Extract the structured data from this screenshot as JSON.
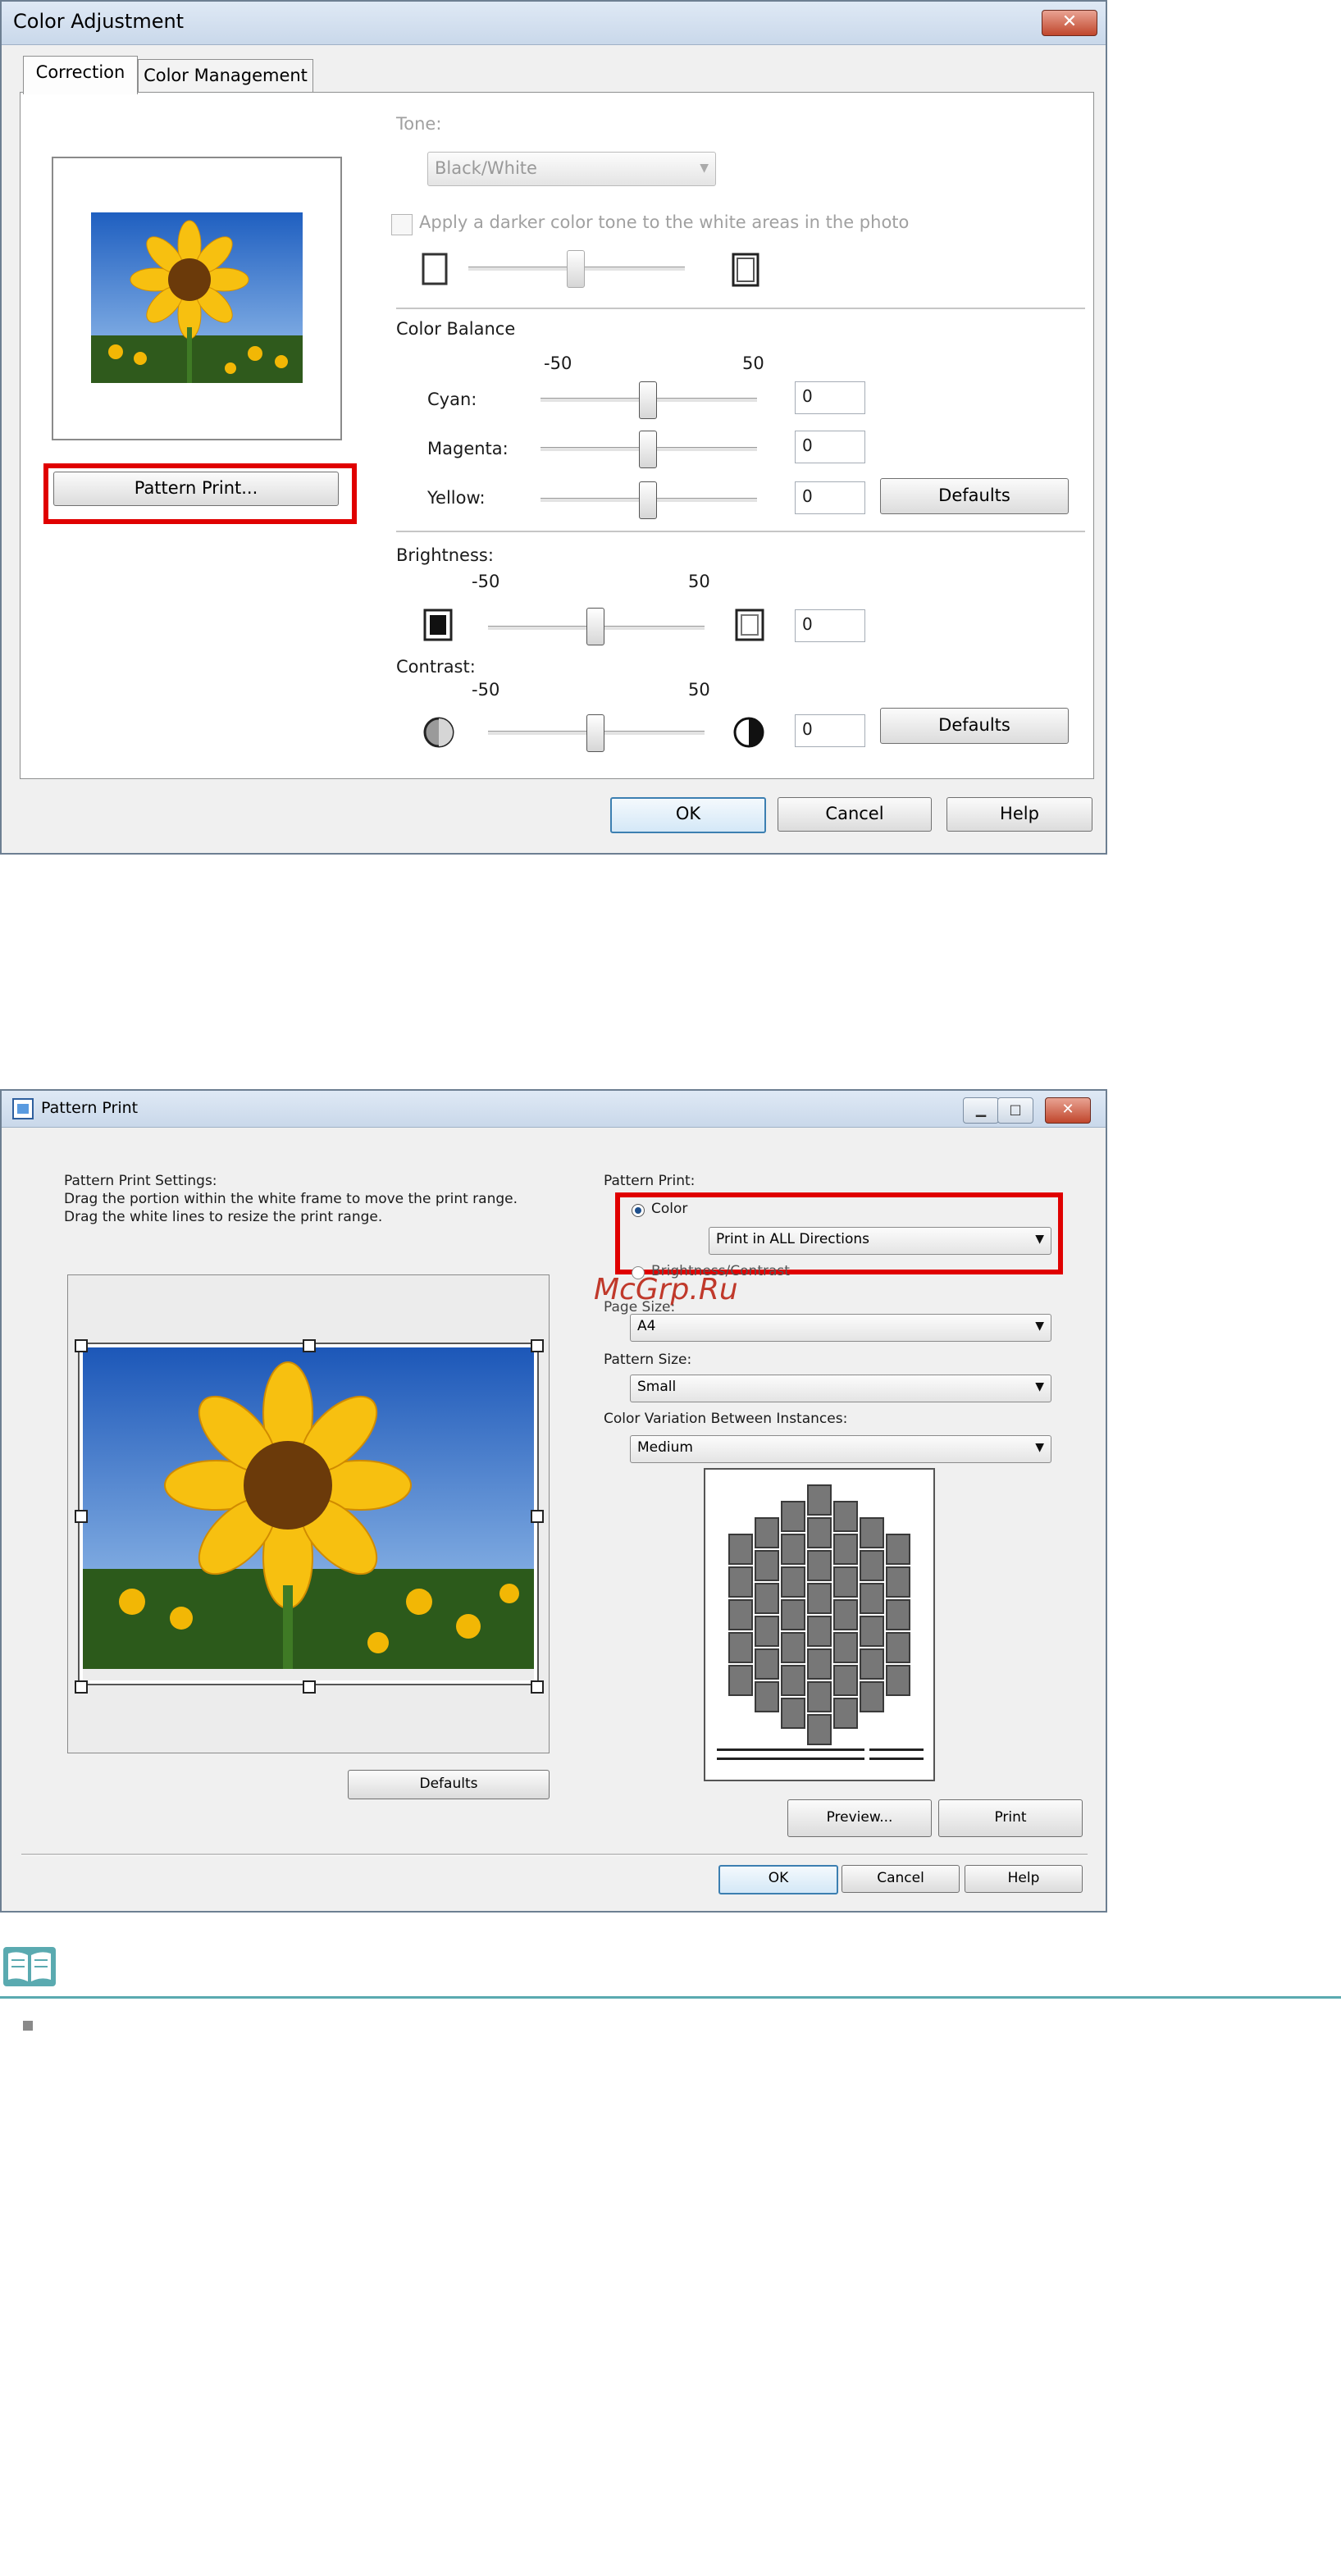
{
  "dialog1": {
    "title": "Color Adjustment",
    "close": "✕",
    "tabs": [
      "Correction",
      "Color Management"
    ],
    "pattern_print_button": "Pattern Print...",
    "tone_label": "Tone:",
    "tone_value": "Black/White",
    "darker_tone_label": "Apply a darker color tone to the white areas in the photo",
    "color_balance_label": "Color Balance",
    "scale_min": "-50",
    "scale_max": "50",
    "cyan_label": "Cyan:",
    "cyan_value": "0",
    "magenta_label": "Magenta:",
    "magenta_value": "0",
    "yellow_label": "Yellow:",
    "yellow_value": "0",
    "defaults_label": "Defaults",
    "brightness_label": "Brightness:",
    "brightness_value": "0",
    "contrast_label": "Contrast:",
    "contrast_value": "0",
    "ok_label": "OK",
    "cancel_label": "Cancel",
    "help_label": "Help"
  },
  "dialog2": {
    "title": "Pattern Print",
    "settings_title": "Pattern Print Settings:",
    "instruction1": "Drag the portion within the white frame to move the print range.",
    "instruction2": "Drag the white lines to resize the print range.",
    "defaults_label": "Defaults",
    "pattern_print_label": "Pattern Print:",
    "color_option": "Color",
    "direction_value": "Print in ALL Directions",
    "brightness_contrast_option": "Brightness/Contrast",
    "paper_size_label": "Page Size:",
    "paper_size_value": "A4",
    "pattern_size_label": "Pattern Size:",
    "pattern_size_value": "Small",
    "variation_label": "Color Variation Between Instances:",
    "variation_value": "Medium",
    "preview_label": "Preview...",
    "print_label": "Print",
    "ok_label": "OK",
    "cancel_label": "Cancel",
    "help_label": "Help"
  },
  "watermark": "McGrp.Ru",
  "colors": {
    "highlight_red": "#e00000",
    "note_rule": "#5aaab0"
  }
}
